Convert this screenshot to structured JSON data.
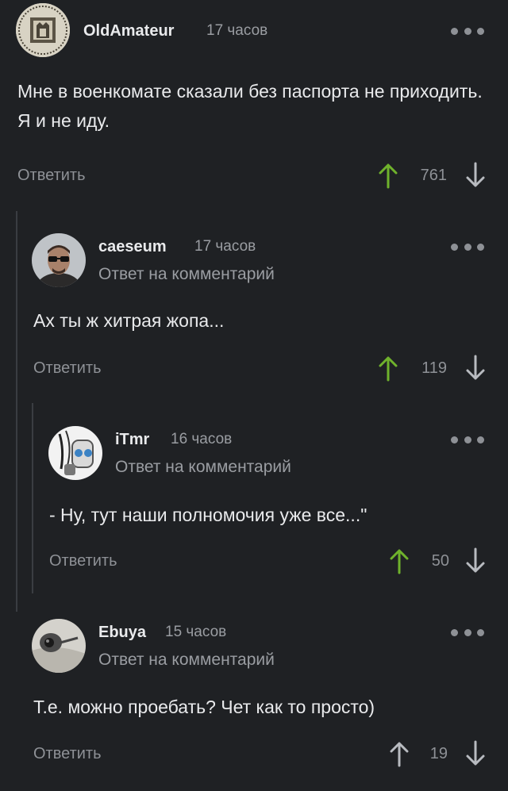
{
  "colors": {
    "background": "#1f2124",
    "upvote_active": "#6fb22c",
    "text_primary": "#e9eaec",
    "text_secondary": "#9a9da2"
  },
  "comments": [
    {
      "username": "OldAmateur",
      "time": "17 часов",
      "reply_note": "",
      "text": "Мне в военкомате сказали без паспорта не приходить. Я и не иду.",
      "reply_label": "Ответить",
      "score": "761",
      "upvoted": true
    },
    {
      "username": "caeseum",
      "time": "17 часов",
      "reply_note": "Ответ на комментарий",
      "text": "Ах ты ж хитрая жопа...",
      "reply_label": "Ответить",
      "score": "119",
      "upvoted": true
    },
    {
      "username": "iTmr",
      "time": "16 часов",
      "reply_note": "Ответ на комментарий",
      "text": "- Ну, тут наши полномочия уже все...\"",
      "reply_label": "Ответить",
      "score": "50",
      "upvoted": true
    },
    {
      "username": "Ebuya",
      "time": "15 часов",
      "reply_note": "Ответ на комментарий",
      "text": "Т.е. можно проебать? Чет как то просто)",
      "reply_label": "Ответить",
      "score": "19",
      "upvoted": false
    }
  ]
}
